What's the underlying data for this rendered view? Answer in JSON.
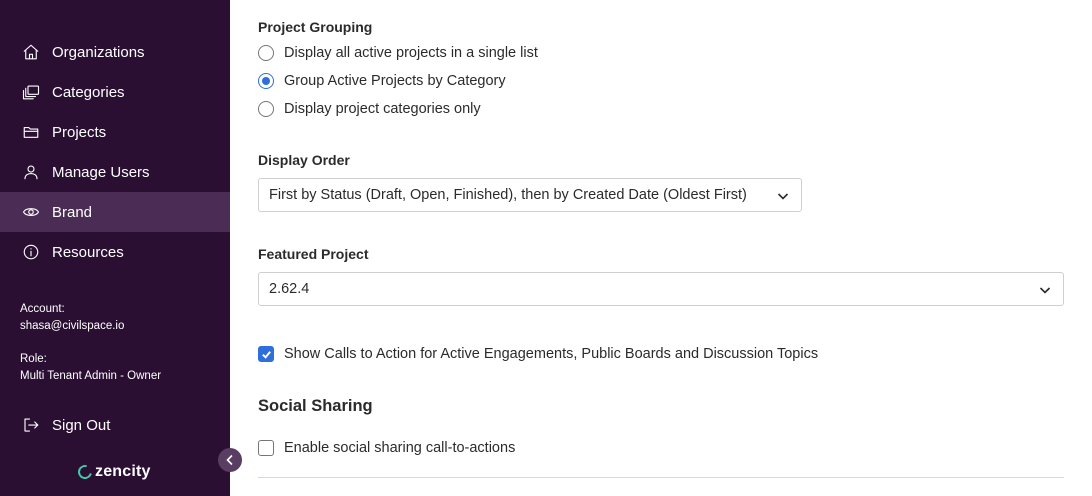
{
  "sidebar": {
    "items": [
      {
        "label": "Organizations",
        "icon": "home-icon"
      },
      {
        "label": "Categories",
        "icon": "layers-icon"
      },
      {
        "label": "Projects",
        "icon": "folder-icon"
      },
      {
        "label": "Manage Users",
        "icon": "user-icon"
      },
      {
        "label": "Brand",
        "icon": "eye-icon",
        "active": true
      },
      {
        "label": "Resources",
        "icon": "info-icon"
      }
    ],
    "account_label": "Account:",
    "account_value": "shasa@civilspace.io",
    "role_label": "Role:",
    "role_value": "Multi Tenant Admin - Owner",
    "sign_out": "Sign Out",
    "logo_text": "zencity",
    "active_color": "#4b2c55",
    "background_color": "#2a0f33"
  },
  "main": {
    "project_grouping": {
      "label": "Project Grouping",
      "options": [
        {
          "label": "Display all active projects in a single list",
          "checked": false
        },
        {
          "label": "Group Active Projects by Category",
          "checked": true
        },
        {
          "label": "Display project categories only",
          "checked": false
        }
      ]
    },
    "display_order": {
      "label": "Display Order",
      "value": "First by Status (Draft, Open, Finished), then by Created Date (Oldest First)"
    },
    "featured_project": {
      "label": "Featured Project",
      "value": "2.62.4"
    },
    "cta_checkbox": {
      "label": "Show Calls to Action for Active Engagements, Public Boards and Discussion Topics",
      "checked": true
    },
    "social_sharing": {
      "heading": "Social Sharing",
      "checkbox_label": "Enable social sharing call-to-actions",
      "checked": false
    },
    "accent_color": "#2f6fdc"
  }
}
